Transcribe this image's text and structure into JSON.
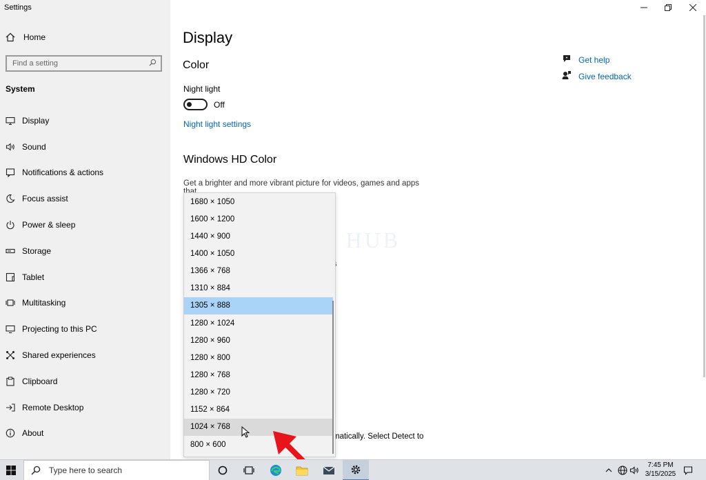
{
  "window": {
    "title": "Settings"
  },
  "sidebar": {
    "home_label": "Home",
    "search_placeholder": "Find a setting",
    "section_label": "System",
    "items": [
      {
        "label": "Display",
        "icon": "monitor-icon"
      },
      {
        "label": "Sound",
        "icon": "speaker-icon"
      },
      {
        "label": "Notifications & actions",
        "icon": "notification-icon"
      },
      {
        "label": "Focus assist",
        "icon": "moon-icon"
      },
      {
        "label": "Power & sleep",
        "icon": "power-icon"
      },
      {
        "label": "Storage",
        "icon": "storage-icon"
      },
      {
        "label": "Tablet",
        "icon": "tablet-icon"
      },
      {
        "label": "Multitasking",
        "icon": "multitasking-icon"
      },
      {
        "label": "Projecting to this PC",
        "icon": "projecting-icon"
      },
      {
        "label": "Shared experiences",
        "icon": "shared-icon"
      },
      {
        "label": "Clipboard",
        "icon": "clipboard-icon"
      },
      {
        "label": "Remote Desktop",
        "icon": "remote-desktop-icon"
      },
      {
        "label": "About",
        "icon": "info-icon"
      }
    ]
  },
  "main": {
    "title": "Display",
    "color_heading": "Color",
    "night_light_label": "Night light",
    "night_light_state": "Off",
    "night_light_link": "Night light settings",
    "hd_heading": "Windows HD Color",
    "hd_description": "Get a brighter and more vibrant picture for videos, games and apps that",
    "fragment_1": "s",
    "fragment_2": "matically. Select Detect to",
    "watermark": "IT Pros HUB",
    "help_links": {
      "get_help": "Get help",
      "give_feedback": "Give feedback"
    }
  },
  "resolution_dropdown": {
    "selected": "1305 × 888",
    "hovered": "1024 × 768",
    "options": [
      "1680 × 1050",
      "1600 × 1200",
      "1440 × 900",
      "1400 × 1050",
      "1366 × 768",
      "1310 × 884",
      "1305 × 888",
      "1280 × 1024",
      "1280 × 960",
      "1280 × 800",
      "1280 × 768",
      "1280 × 720",
      "1152 × 864",
      "1024 × 768",
      "800 × 600"
    ]
  },
  "taskbar": {
    "search_placeholder": "Type here to search",
    "time": "7:45 PM",
    "date": "3/15/2025"
  },
  "colors": {
    "accent": "#0064b4",
    "selected": "#a9d4f7",
    "taskbar": "#dfe3e8"
  }
}
